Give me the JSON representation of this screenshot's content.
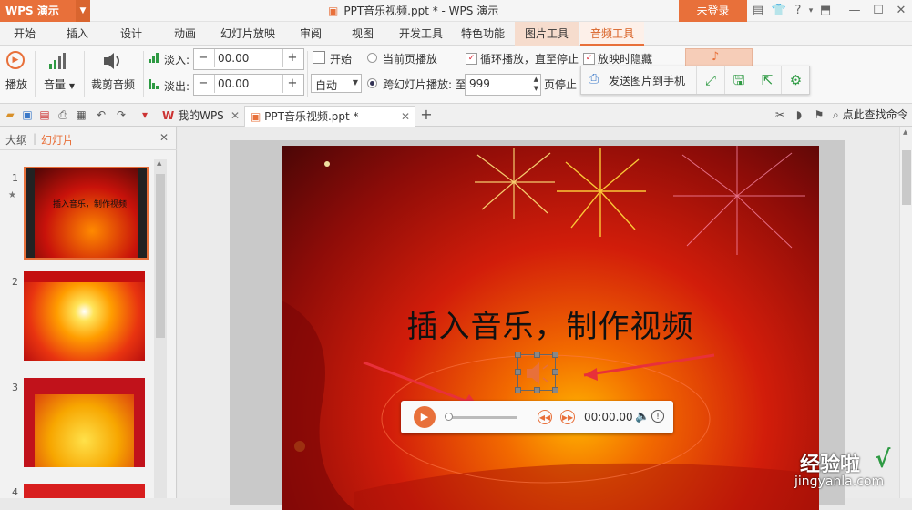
{
  "app": {
    "menu_label": "WPS 演示",
    "doc_title": "PPT音乐视频.ppt * - WPS 演示",
    "login_label": "未登录"
  },
  "ribbon_tabs": [
    "开始",
    "插入",
    "设计",
    "动画",
    "幻灯片放映",
    "审阅",
    "视图",
    "开发工具",
    "特色功能",
    "图片工具",
    "音频工具"
  ],
  "ribbon": {
    "play_label": "播放",
    "volume_label": "音量",
    "trim_label": "裁剪音频",
    "fade_in_label": "淡入:",
    "fade_in_value": "00.00",
    "fade_out_label": "淡出:",
    "fade_out_value": "00.00",
    "start_label": "开始",
    "start_mode_value": "自动",
    "current_page_label": "当前页播放",
    "cross_slide_label": "跨幻灯片播放: 至",
    "cross_slide_value": "999",
    "page_stop_label": "页停止",
    "loop_label": "循环播放，直至停止",
    "hide_label": "放映时隐藏",
    "send_to_phone_label": "发送图片到手机"
  },
  "doc_tabs": [
    {
      "label": "我的WPS"
    },
    {
      "label": "PPT音乐视频.ppt *"
    }
  ],
  "search": {
    "placeholder": "点此查找命令"
  },
  "left_pane": {
    "outline_tab": "大纲",
    "slides_tab": "幻灯片",
    "thumb1_title": "插入音乐，制作视频",
    "slide_numbers": [
      "1",
      "2",
      "3",
      "4"
    ]
  },
  "slide": {
    "title": "插入音乐，制作视频"
  },
  "player": {
    "time": "00:00.00"
  },
  "watermark": {
    "line1": "经验啦",
    "line2": "jingyanla.com",
    "check": "√"
  },
  "colors": {
    "accent": "#e8703a",
    "context_tab": "#f6dccd",
    "green_icon": "#2e9a43"
  }
}
